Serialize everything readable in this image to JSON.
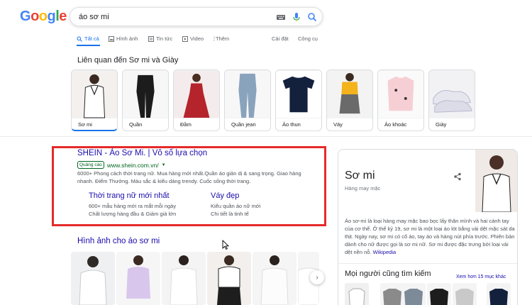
{
  "header": {
    "logo": [
      "G",
      "o",
      "o",
      "g",
      "l",
      "e"
    ],
    "logo_colors": [
      "#4285f4",
      "#ea4335",
      "#fbbc05",
      "#4285f4",
      "#34a853",
      "#ea4335"
    ],
    "search_value": "áo sơ mi"
  },
  "tabs": {
    "items": [
      {
        "label": "Tất cả",
        "icon": "search-icon"
      },
      {
        "label": "Hình ảnh",
        "icon": "image-icon"
      },
      {
        "label": "Tin tức",
        "icon": "news-icon"
      },
      {
        "label": "Video",
        "icon": "video-icon"
      },
      {
        "label": "Thêm",
        "icon": "more-icon"
      }
    ],
    "settings": "Cài đặt",
    "tools": "Công cụ"
  },
  "related": {
    "title": "Liên quan đến Sơ mi và Giày",
    "items": [
      "Sơ mi",
      "Quần",
      "Đầm",
      "Quần jean",
      "Áo thun",
      "Váy",
      "Áo khoác",
      "Giày"
    ]
  },
  "ad": {
    "title": "SHEIN - Áo Sơ Mi. | Vô số lựa chọn",
    "badge": "Quảng cáo",
    "url": "www.shein.com.vn/",
    "description": "6000+ Phong cách thời trang nữ. Mua hàng mới nhất.Quần áo giản dị & sang trọng. Giao hàng nhanh. Điểm Thưởng. Màu sắc & kiểu dáng trendy. Cuốc sống thời trang.",
    "sitelinks": [
      {
        "title": "Thời trang nữ mới nhất",
        "line1": "600+ mẫu hàng mới ra mắt mỗi ngày",
        "line2": "Chất lượng hàng đầu & Giảm giá lớn"
      },
      {
        "title": "Váy đẹp",
        "line1": "Kiểu quần áo nữ mới",
        "line2": "Chi tiết là tinh tế"
      }
    ]
  },
  "images": {
    "title": "Hình ảnh cho áo sơ mi"
  },
  "knowledge_panel": {
    "title": "Sơ mi",
    "subtitle": "Hàng may mặc",
    "description": "Áo sơ-mi là loại hàng may mặc bao bọc lấy thân mình và hai cánh tay của cơ thể. Ở thế kỷ 19, sơ mi là một loại áo lót bằng vải dệt mặc sát da thịt. Ngày nay, sơ mi có cổ áo, tay áo và hàng nút phía trước. Phiên bản dành cho nữ được gọi là sơ mi nữ. Sơ mi được đặc trưng bởi loại vải dệt nền nỗ.",
    "wiki": "Wikipedia",
    "people_also": "Mọi người cũng tìm kiếm",
    "see_more": "Xem hơn 15 mục khác"
  }
}
